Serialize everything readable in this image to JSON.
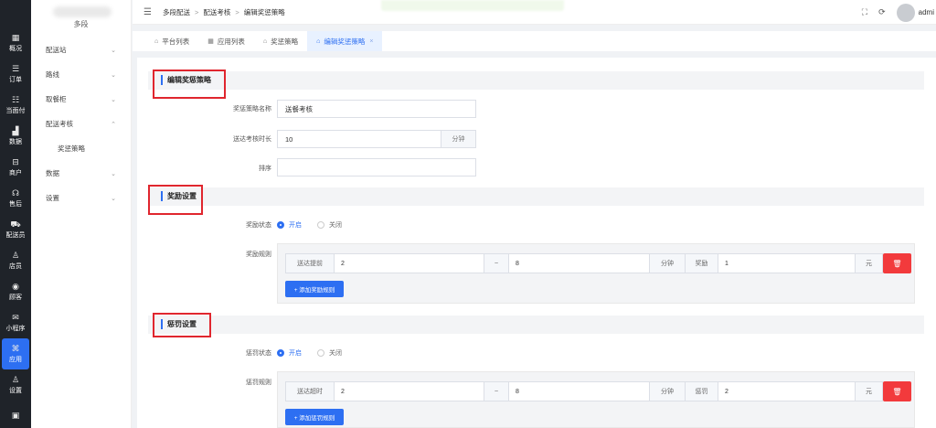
{
  "rail": {
    "items": [
      {
        "label": "概况",
        "icon": "overview-icon",
        "glyph": "▦"
      },
      {
        "label": "订单",
        "icon": "order-icon",
        "glyph": "☰"
      },
      {
        "label": "当面付",
        "icon": "pay-icon",
        "glyph": "☷"
      },
      {
        "label": "数据",
        "icon": "chart-icon",
        "glyph": "▟"
      },
      {
        "label": "商户",
        "icon": "shop-icon",
        "glyph": "⊟"
      },
      {
        "label": "售后",
        "icon": "headset-icon",
        "glyph": "☊"
      },
      {
        "label": "配送员",
        "icon": "courier-icon",
        "glyph": "⛟"
      },
      {
        "label": "店员",
        "icon": "staff-icon",
        "glyph": "♙"
      },
      {
        "label": "顾客",
        "icon": "customer-icon",
        "glyph": "◉"
      },
      {
        "label": "小程序",
        "icon": "miniapp-icon",
        "glyph": "✉"
      },
      {
        "label": "应用",
        "icon": "apps-icon",
        "glyph": "⌘"
      },
      {
        "label": "设置",
        "icon": "settings-icon",
        "glyph": "♙"
      },
      {
        "label": "",
        "icon": "lock-icon",
        "glyph": "▣"
      }
    ]
  },
  "sidebar": {
    "header": "多段",
    "items": [
      {
        "label": "配送站",
        "chev": "⌄"
      },
      {
        "label": "路线",
        "chev": "⌄"
      },
      {
        "label": "取餐柜",
        "chev": "⌄"
      },
      {
        "label": "配送考核",
        "chev": "⌃"
      }
    ],
    "sub_item": "奖惩策略",
    "items2": [
      {
        "label": "数据",
        "chev": "⌄"
      },
      {
        "label": "设置",
        "chev": "⌄"
      }
    ]
  },
  "header": {
    "menu_icon": "☰",
    "breadcrumb": [
      "多段配送",
      "配送考核",
      "编辑奖惩策略"
    ],
    "sep": ">",
    "fullscreen_icon": "⛶",
    "refresh_icon": "⟳",
    "user": "admi"
  },
  "tabs": [
    {
      "label": "平台列表",
      "icon": "⌂"
    },
    {
      "label": "应用列表",
      "icon": "▦"
    },
    {
      "label": "奖惩策略",
      "icon": "⌂"
    },
    {
      "label": "编辑奖惩策略",
      "icon": "⌂",
      "close": "×"
    }
  ],
  "form": {
    "section1_title": "编辑奖惩策略",
    "name_label": "奖惩策略名称",
    "name_value": "送餐考核",
    "duration_label": "送达考核时长",
    "duration_value": "10",
    "duration_unit": "分钟",
    "sort_label": "排序",
    "sort_value": ""
  },
  "reward": {
    "title": "奖励设置",
    "status_label": "奖励状态",
    "on_label": "开启",
    "off_label": "关闭",
    "rule_label": "奖励规则",
    "rule": {
      "prefix": "送达提前",
      "from": "2",
      "tilde": "~",
      "to": "8",
      "unit": "分钟",
      "action": "奖励",
      "amount": "1",
      "currency": "元",
      "delete_icon": "🗑"
    },
    "add_button": "+ 添加奖励规则"
  },
  "penalty": {
    "title": "惩罚设置",
    "status_label": "惩罚状态",
    "on_label": "开启",
    "off_label": "关闭",
    "rule_label": "惩罚规则",
    "rule": {
      "prefix": "送达超时",
      "from": "2",
      "tilde": "~",
      "to": "8",
      "unit": "分钟",
      "action": "惩罚",
      "amount": "2",
      "currency": "元",
      "delete_icon": "🗑"
    },
    "add_button": "+ 添加惩罚规则"
  }
}
